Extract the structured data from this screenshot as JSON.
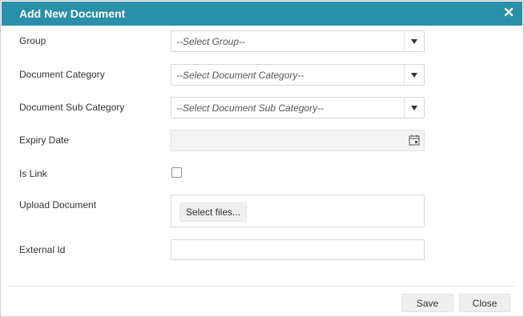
{
  "dialog": {
    "title": "Add New Document",
    "close_icon": "close-icon"
  },
  "form": {
    "group": {
      "label": "Group",
      "placeholder": "--Select Group--"
    },
    "document_category": {
      "label": "Document Category",
      "placeholder": "--Select Document Category--"
    },
    "document_sub_category": {
      "label": "Document Sub Category",
      "placeholder": "--Select Document Sub Category--"
    },
    "expiry_date": {
      "label": "Expiry Date",
      "value": "",
      "icon": "calendar-icon"
    },
    "is_link": {
      "label": "Is Link",
      "checked": false
    },
    "upload_document": {
      "label": "Upload Document",
      "button_label": "Select files..."
    },
    "external_id": {
      "label": "External Id",
      "value": ""
    }
  },
  "footer": {
    "save_label": "Save",
    "close_label": "Close"
  },
  "colors": {
    "titlebar": "#2a8fa8",
    "title_text": "#ffffff"
  }
}
